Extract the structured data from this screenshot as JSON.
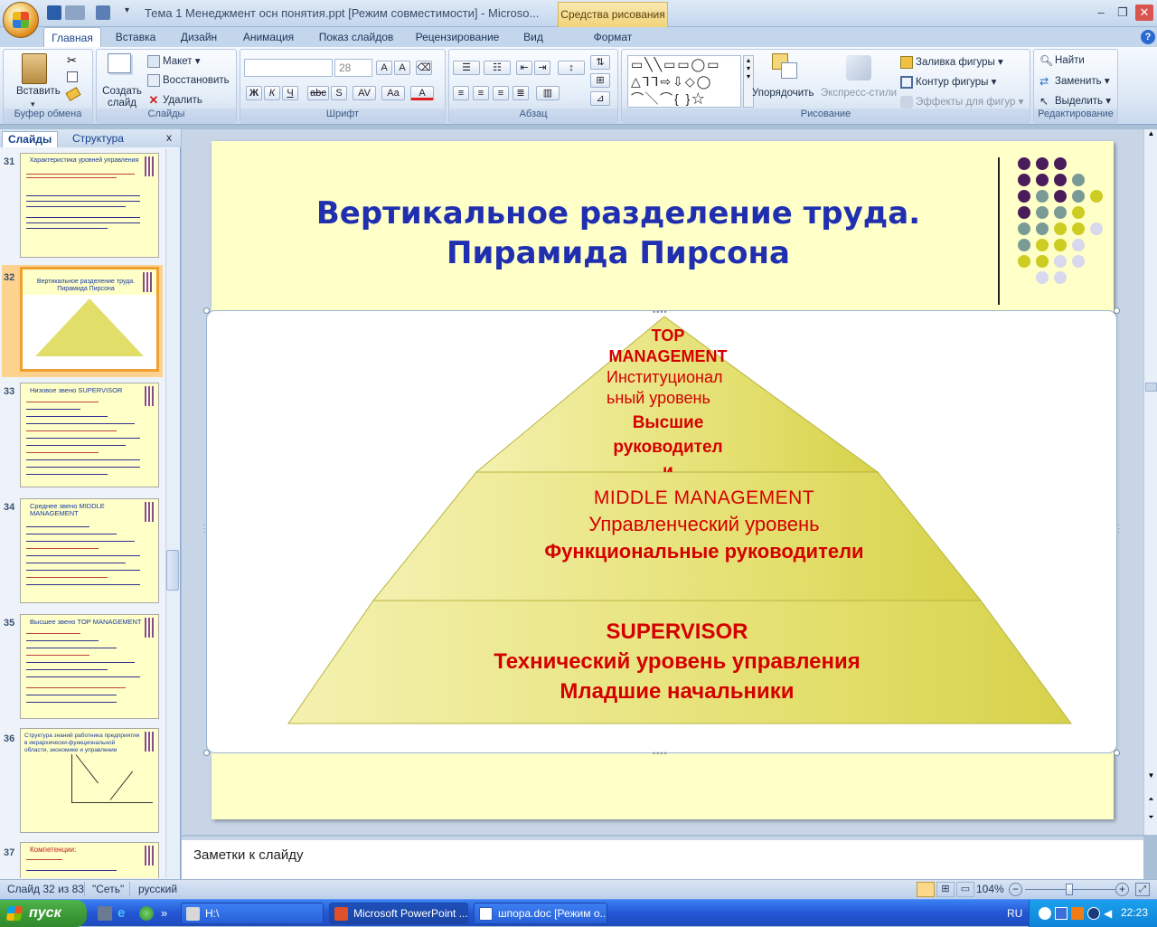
{
  "window": {
    "title": "Тема 1 Менеджмент  осн понятия.ppt [Режим совместимости] - Microso...",
    "context_tab": "Средства рисования"
  },
  "ribbon_tabs": [
    "Главная",
    "Вставка",
    "Дизайн",
    "Анимация",
    "Показ слайдов",
    "Рецензирование",
    "Вид",
    "Формат"
  ],
  "ribbon": {
    "clipboard": {
      "label": "Буфер обмена",
      "paste": "Вставить"
    },
    "slides": {
      "label": "Слайды",
      "new_slide": "Создать слайд",
      "layout": "Макет",
      "reset": "Восстановить",
      "delete": "Удалить"
    },
    "font": {
      "label": "Шрифт",
      "font_name": "",
      "font_size": "28"
    },
    "paragraph": {
      "label": "Абзац"
    },
    "drawing": {
      "label": "Рисование",
      "arrange": "Упорядочить",
      "quick_styles": "Экспресс-стили",
      "fill": "Заливка фигуры",
      "outline": "Контур фигуры",
      "effects": "Эффекты для фигур"
    },
    "editing": {
      "label": "Редактирование",
      "find": "Найти",
      "replace": "Заменить",
      "select": "Выделить"
    }
  },
  "left_panel": {
    "tabs": [
      "Слайды",
      "Структура"
    ],
    "close": "x",
    "thumbnails": [
      {
        "num": "31",
        "title": "Характеристика уровней управления"
      },
      {
        "num": "32",
        "title": "Вертикальное разделение труда. Пирамида Пирсона",
        "selected": true
      },
      {
        "num": "33",
        "title": "Низовое звено    SUPERVISOR"
      },
      {
        "num": "34",
        "title": "Среднее звено MIDDLE MANAGEMENT"
      },
      {
        "num": "35",
        "title": "Высшее звено TOP MANAGEMENT"
      },
      {
        "num": "36",
        "title": "Структура знаний работника предприятия в иерархически-функциональной области, экономике и управлении"
      },
      {
        "num": "37",
        "title": "Компетенции:"
      }
    ]
  },
  "slide": {
    "title_line1": "Вертикальное разделение труда.",
    "title_line2": "Пирамида Пирсона",
    "pyramid": {
      "top": {
        "l1": "TOP",
        "l2": "MANAGEMENT",
        "l3": "Институционал",
        "l4": "ьный уровень",
        "l5": "Высшие",
        "l6": "руководител",
        "l7": "и"
      },
      "middle": {
        "l1": "MIDDLE  MANAGEMENT",
        "l2": "Управленческий уровень",
        "l3": "Функциональные  руководители"
      },
      "bottom": {
        "l1": "SUPERVISOR",
        "l2": "Технический уровень управления",
        "l3": "Младшие начальники"
      }
    },
    "colors": {
      "background": "#ffffc8",
      "title": "#1f2fb0",
      "pyramid_text": "#d40000",
      "pyramid_fill": "#e2de6a"
    }
  },
  "notes": {
    "placeholder": "Заметки к слайду"
  },
  "status": {
    "slide": "Слайд 32 из 83",
    "theme": "\"Сеть\"",
    "language": "русский",
    "zoom": "104%"
  },
  "taskbar": {
    "start": "пуск",
    "tasks": [
      "H:\\",
      "Microsoft PowerPoint ...",
      "шпора.doc [Режим о..."
    ],
    "lang": "RU",
    "clock": "22:23"
  }
}
